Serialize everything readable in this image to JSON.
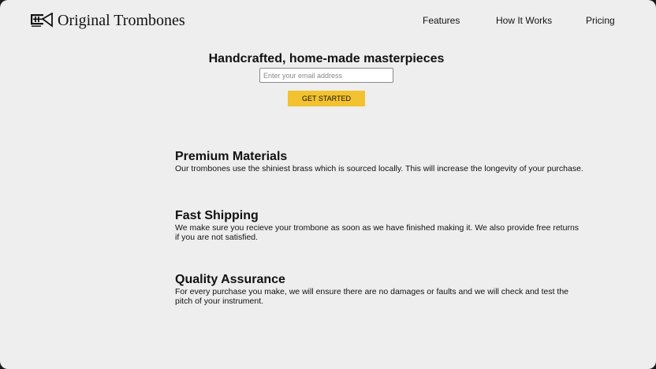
{
  "brand": {
    "name": "Original Trombones",
    "icon": "trombone-logo-icon"
  },
  "nav": {
    "items": [
      {
        "label": "Features"
      },
      {
        "label": "How It Works"
      },
      {
        "label": "Pricing"
      }
    ]
  },
  "hero": {
    "title": "Handcrafted, home-made masterpieces",
    "email_placeholder": "Enter your email address",
    "email_value": "",
    "cta_label": "GET STARTED"
  },
  "features": [
    {
      "title": "Premium Materials",
      "text": "Our trombones use the shiniest brass which is sourced locally. This will increase the longevity of your purchase."
    },
    {
      "title": "Fast Shipping",
      "text": "We make sure you recieve your trombone as soon as we have finished making it. We also provide free returns if you are not satisfied."
    },
    {
      "title": "Quality Assurance",
      "text": "For every purchase you make, we will ensure there are no damages or faults and we will check and test the pitch of your instrument."
    }
  ],
  "colors": {
    "accent": "#f2c230",
    "background": "#eeeeee",
    "text": "#111111"
  }
}
